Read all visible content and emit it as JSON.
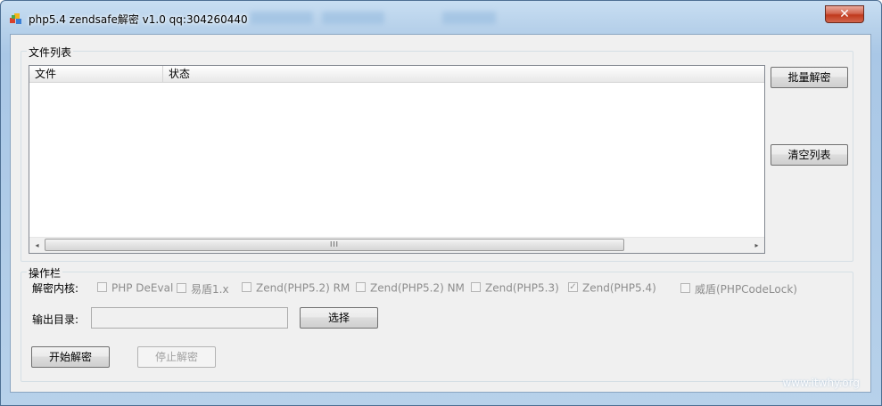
{
  "window": {
    "title": "php5.4 zendsafe解密 v1.0  qq:304260440",
    "close_label": "✕"
  },
  "file_group": {
    "legend": "文件列表",
    "columns": [
      "文件",
      "状态"
    ],
    "scroll_left": "◂",
    "scroll_right": "▸",
    "scroll_grip": "III",
    "batch_button": "批量解密",
    "clear_button": "清空列表"
  },
  "ops_group": {
    "legend": "操作栏",
    "kernel_label": "解密内核:",
    "kernels": [
      {
        "label": "PHP DeEval",
        "checked": false
      },
      {
        "label": "易盾1.x",
        "checked": false
      },
      {
        "label": "Zend(PHP5.2) RM",
        "checked": false
      },
      {
        "label": "Zend(PHP5.2) NM",
        "checked": false
      },
      {
        "label": "Zend(PHP5.3)",
        "checked": false
      },
      {
        "label": "Zend(PHP5.4)",
        "checked": true
      },
      {
        "label": "威盾(PHPCodeLock)",
        "checked": false
      }
    ],
    "output_label": "输出目录:",
    "output_value": "",
    "select_button": "选择",
    "start_button": "开始解密",
    "stop_button": "停止解密"
  },
  "watermark": "www.itwhy.org"
}
